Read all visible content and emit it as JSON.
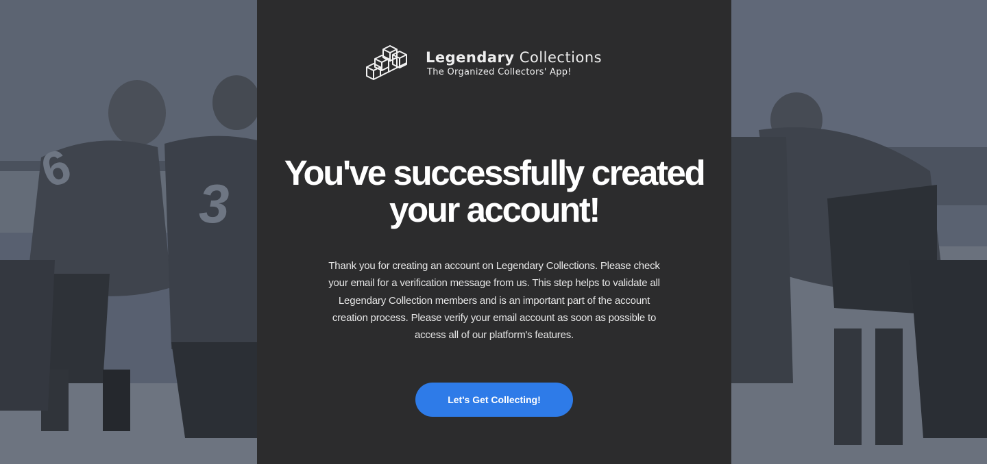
{
  "brand": {
    "name_bold": "Legendary",
    "name_light": "Collections",
    "tagline": "The Organized Collectors' App!",
    "logo_icon": "stacked-boxes-icon"
  },
  "headline": {
    "line1": "You've successfully created",
    "line2": "your account!"
  },
  "message": "Thank you for creating an account on Legendary Collections. Please check your email for a verification message from us. This step helps to validate all Legendary Collection members and is an important part of the account creation process. Please verify your email account as soon as possible to access all of our platform's features.",
  "cta": {
    "label": "Let's Get Collecting!"
  },
  "colors": {
    "panel": "#2c2c2d",
    "background_tint": "#4f5663",
    "cta": "#2e7be8",
    "text": "#ffffff"
  },
  "background_photo": {
    "left_jersey_numbers": [
      "6",
      "3"
    ]
  }
}
